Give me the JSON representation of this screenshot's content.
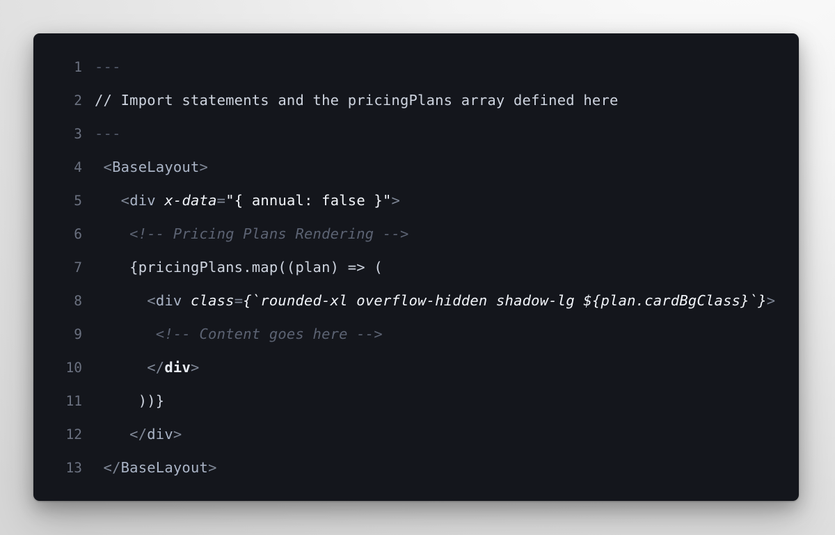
{
  "window": {
    "background_top_color": "#fbfbfb",
    "background_bottom_color": "#d6d6d6",
    "card_background_color": "#14161c",
    "card_radius_px": 9
  },
  "editor": {
    "language": "astro",
    "line_number_color": "#6b7180",
    "default_text_color": "#cdd3de",
    "comment_color": "#5c6373",
    "line_count": 13,
    "lines": [
      {
        "number": "1",
        "text": "---"
      },
      {
        "number": "2",
        "text": "// Import statements and the pricingPlans array defined here"
      },
      {
        "number": "3",
        "text": "---"
      },
      {
        "number": "4",
        "text": " <BaseLayout>"
      },
      {
        "number": "5",
        "text": "   <div x-data=\"{ annual: false }\">"
      },
      {
        "number": "6",
        "text": "    <!-- Pricing Plans Rendering -->"
      },
      {
        "number": "7",
        "text": "    {pricingPlans.map((plan) => ("
      },
      {
        "number": "8",
        "text": "      <div class={`rounded-xl overflow-hidden shadow-lg ${plan.cardBgClass}`}>"
      },
      {
        "number": "9",
        "text": "       <!-- Content goes here -->"
      },
      {
        "number": "10",
        "text": "      </div>"
      },
      {
        "number": "11",
        "text": "     ))}"
      },
      {
        "number": "12",
        "text": "    </div>"
      },
      {
        "number": "13",
        "text": " </BaseLayout>"
      }
    ],
    "tokens": {
      "line1": {
        "frontmatter": "---"
      },
      "line2": {
        "comment": "// Import statements and the pricingPlans array defined here"
      },
      "line3": {
        "frontmatter": "---"
      },
      "line4": {
        "open_bracket": "<",
        "tag_name": "BaseLayout",
        "close_bracket": ">"
      },
      "line5": {
        "open_bracket": "<",
        "tag_name": "div",
        "attr_name": "x-data",
        "equals": "=",
        "attr_value": "\"{ annual: false }\"",
        "close_bracket": ">"
      },
      "line6": {
        "comment": "<!-- Pricing Plans Rendering -->"
      },
      "line7": {
        "expression": "{pricingPlans.map((plan) => ("
      },
      "line8": {
        "open_bracket": "<",
        "tag_name": "div",
        "attr_name": "class",
        "equals": "=",
        "template_literal": "{`rounded-xl overflow-hidden shadow-lg ${plan.cardBgClass}`}",
        "close_bracket": ">"
      },
      "line9": {
        "comment": "<!-- Content goes here -->"
      },
      "line10": {
        "open": "</",
        "tag_name": "div",
        "close": ">"
      },
      "line11": {
        "expression": "))}"
      },
      "line12": {
        "open": "</",
        "tag_name": "div",
        "close": ">"
      },
      "line13": {
        "open": "</",
        "tag_name": "BaseLayout",
        "close": ">"
      }
    }
  }
}
